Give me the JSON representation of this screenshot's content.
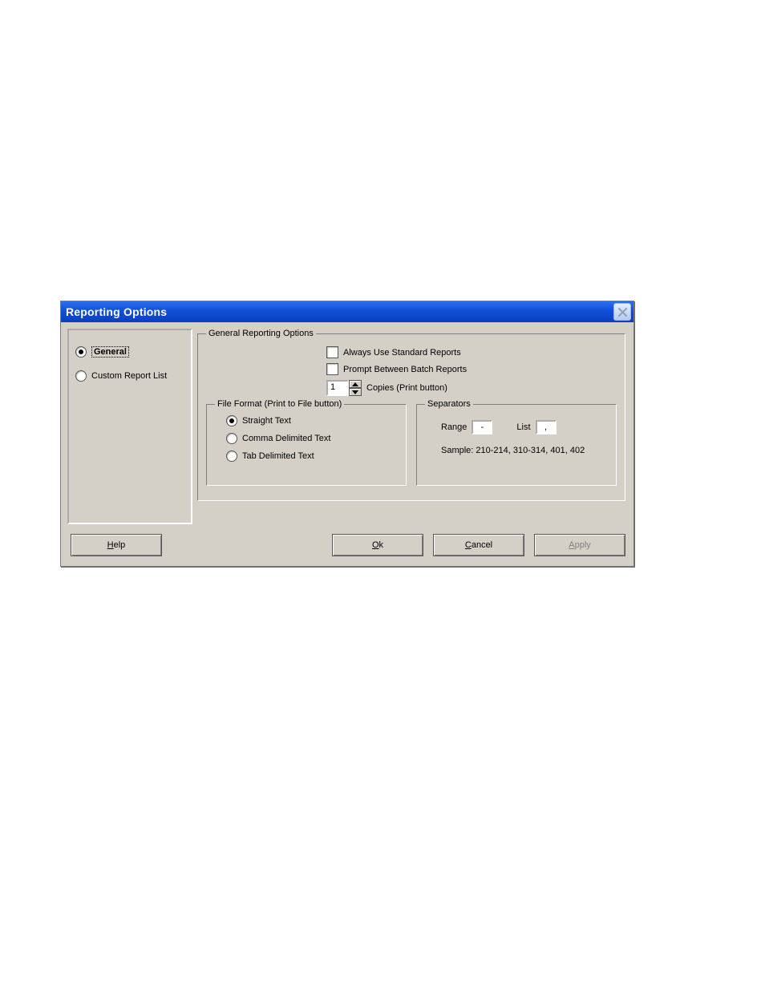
{
  "dialog": {
    "title": "Reporting Options",
    "close_icon_name": "close-icon"
  },
  "sidebar": {
    "options": [
      {
        "label": "General",
        "selected": true
      },
      {
        "label": "Custom Report List",
        "selected": false
      }
    ]
  },
  "general_group": {
    "legend": "General Reporting Options",
    "always_use_standard_label": "Always Use Standard Reports",
    "always_use_standard_checked": false,
    "prompt_between_label": "Prompt Between Batch Reports",
    "prompt_between_checked": false,
    "copies_value": "1",
    "copies_label": "Copies (Print button)"
  },
  "file_format_group": {
    "legend": "File Format (Print to File button)",
    "options": [
      {
        "label": "Straight Text",
        "selected": true
      },
      {
        "label": "Comma Delimited Text",
        "selected": false
      },
      {
        "label": "Tab Delimited Text",
        "selected": false
      }
    ]
  },
  "separators_group": {
    "legend": "Separators",
    "range_label": "Range",
    "range_value": "-",
    "list_label": "List",
    "list_value": ",",
    "sample_label": "Sample:  210-214, 310-314, 401, 402"
  },
  "buttons": {
    "help": {
      "text": "Help",
      "mnemonic": "H"
    },
    "ok": {
      "text": "Ok",
      "mnemonic": "O"
    },
    "cancel": {
      "text": "Cancel",
      "mnemonic": "C"
    },
    "apply": {
      "text": "Apply",
      "mnemonic": "A",
      "disabled": true
    }
  }
}
